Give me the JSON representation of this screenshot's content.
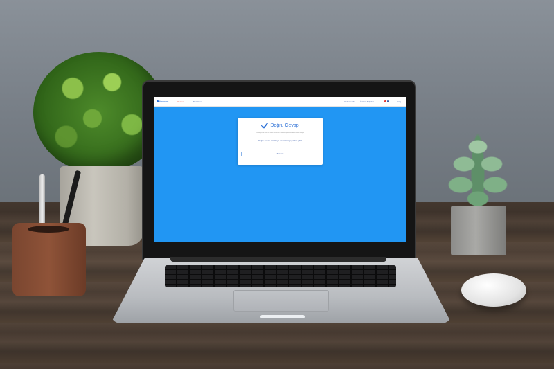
{
  "screen": {
    "header": {
      "brand": "Kapsim",
      "nav_active": "Hemen",
      "nav_link": "Nasılsınız",
      "right_links": [
        "Hakkımızda",
        "İletişim Bilgileri"
      ],
      "login": "Giriş"
    },
    "modal": {
      "title": "Doğru Cevap",
      "subtitle": "Lorem ipsum dolor sit amet consectetur adipiscing elit sed do eiusmod tempor",
      "message": "Doğru cevap \"Arabaya kadar hangi yoldan gitti\"",
      "button_label": "Tamam"
    },
    "colors": {
      "background": "#2196f3",
      "accent": "#2a6fd6",
      "active_nav": "#e53935",
      "check": "#2a6fd6"
    },
    "icons": [
      "check-icon",
      "kapsim-logo-icon",
      "flag-tr-icon",
      "flag-en-icon"
    ]
  }
}
